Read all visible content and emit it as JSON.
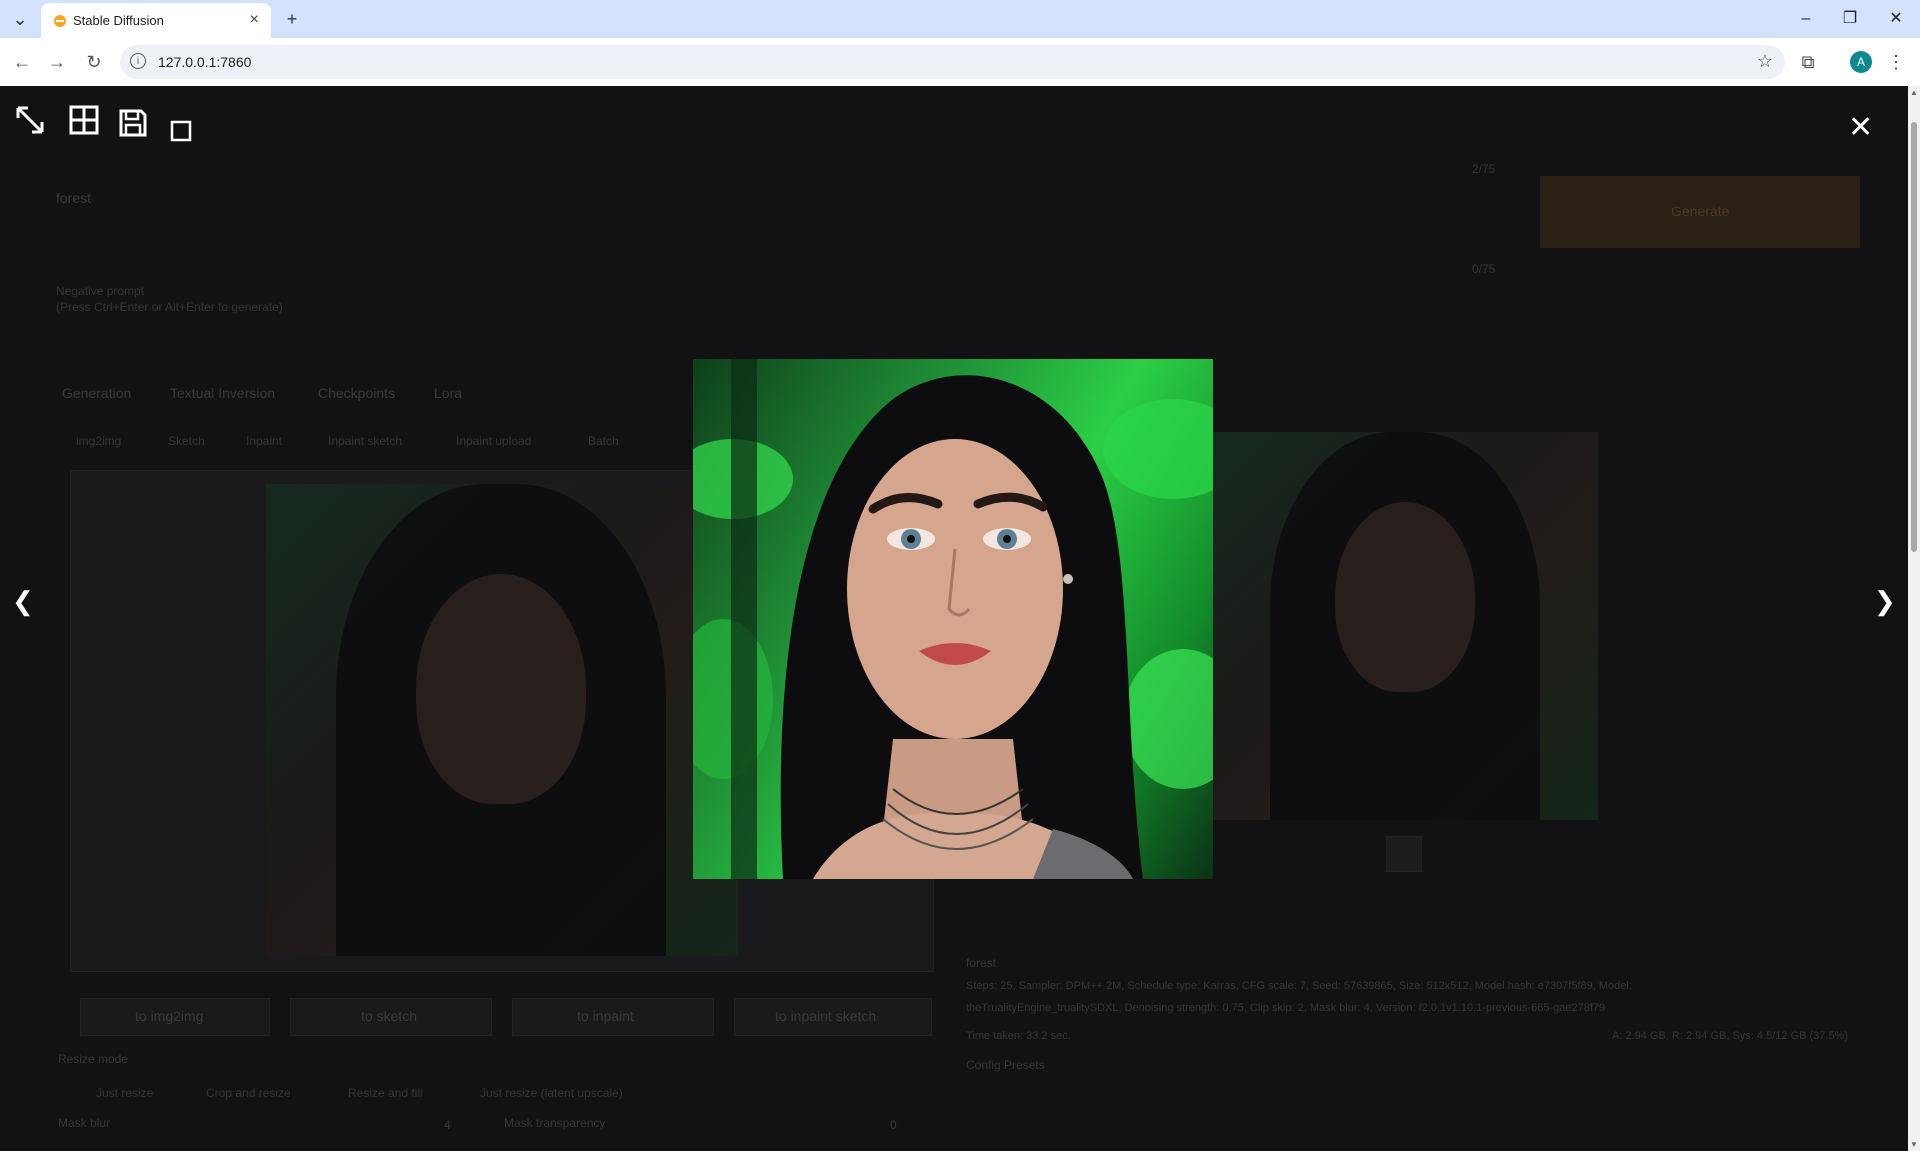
{
  "browser": {
    "tab_title": "Stable Diffusion",
    "url": "127.0.0.1:7860",
    "avatar_letter": "A"
  },
  "background": {
    "prompt_text": "forest",
    "prompt_counter_top": "2/75",
    "prompt_counter_neg": "0/75",
    "neg_placeholder": "Negative prompt",
    "neg_hint": "(Press Ctrl+Enter or Alt+Enter to generate)",
    "generate_label": "Generate",
    "tabs": [
      "Generation",
      "Textual Inversion",
      "Checkpoints",
      "Lora"
    ],
    "subtabs": [
      "img2img",
      "Sketch",
      "Inpaint",
      "Inpaint sketch",
      "Inpaint upload",
      "Batch"
    ],
    "send_buttons": [
      "to img2img",
      "to sketch",
      "to inpaint",
      "to inpaint sketch"
    ],
    "resize_mode_label": "Resize mode",
    "resize_options": [
      "Just resize",
      "Crop and resize",
      "Resize and fill",
      "Just resize (latent upscale)"
    ],
    "mask_blur_label": "Mask blur",
    "mask_blur_value": "4",
    "mask_transparency_label": "Mask transparency",
    "mask_transparency_value": "0",
    "info_prompt": "forest",
    "info_line1": "Steps: 25, Sampler: DPM++ 2M, Schedule type: Karras, CFG scale: 7, Seed: 57639865, Size: 512x512, Model hash: e7307f5f89, Model:",
    "info_line2": "theTrualityEngine_trualitySDXL, Denoising strength: 0.75, Clip skip: 2, Mask blur: 4, Version: f2.0.1v1.10.1-previous-665-gae278f79",
    "time_taken": "Time taken: 33.2 sec.",
    "vram": "A: 2.94 GB, R: 2.94 GB, Sys: 4.5/12 GB (37.5%)",
    "html_info_label": "Config Presets"
  },
  "lightbox": {
    "toolbar_icons": [
      "fullscreen-toggle-icon",
      "tile-grid-icon",
      "save-icon",
      "zoom-fit-icon"
    ],
    "close_glyph": "✕",
    "prev_glyph": "❮",
    "next_glyph": "❯"
  }
}
